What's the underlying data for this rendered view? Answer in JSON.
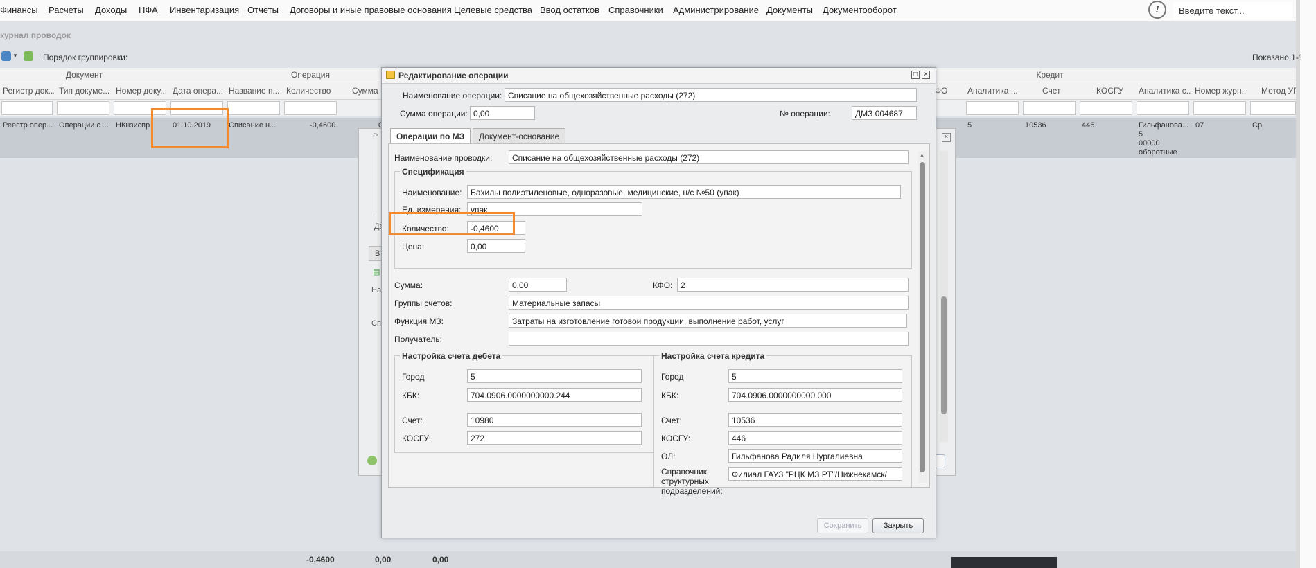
{
  "menu": [
    "Финансы",
    "Расчеты",
    "Доходы",
    "НФА",
    "Инвентаризация",
    "Отчеты",
    "Договоры и иные правовые основания",
    "Целевые средства",
    "Ввод остатков",
    "Справочники",
    "Администрирование",
    "Документы",
    "Документооборот"
  ],
  "search": {
    "placeholder": "Введите текст..."
  },
  "journal": {
    "title": "курнал проводок",
    "group_order_label": "Порядок группировки:",
    "shown": "Показано 1-1",
    "groups": {
      "document": "Документ",
      "operation": "Операция",
      "credit": "Кредит"
    },
    "columns": [
      "Регистр док...",
      "Тип докуме...",
      "Номер доку...",
      "Дата опера...",
      "Название п...",
      "Количество",
      "Сумма",
      "ФО",
      "Аналитика ...",
      "Счет",
      "КОСГУ",
      "Аналитика с...",
      "Номер журн...",
      "Метод УП"
    ],
    "row": {
      "register": "Реестр опер...",
      "doc_type": "Операции с ...",
      "doc_number": "НКнзиспр",
      "date": "01.10.2019",
      "name": "Списание н...",
      "quantity": "-0,4600",
      "sum": "0",
      "credit_analytics": "5",
      "credit_account": "10536",
      "credit_kosgu": "446",
      "analytics_s": [
        "Гильфанова...",
        "5",
        "00000",
        "оборотные"
      ],
      "journal_num": "07",
      "method": "Ср"
    },
    "totals": [
      "-0,4600",
      "0,00",
      "0,00"
    ]
  },
  "bg_dialog": {
    "title_letter": "Р",
    "label_d": "Да",
    "label_nac": "Нас",
    "label_sp": "Спи",
    "tab_letter": "В"
  },
  "dialog": {
    "title": "Редактирование операции",
    "op_name_label": "Наименование операции:",
    "op_name": "Списание на общехозяйственные расходы (272)",
    "op_sum_label": "Сумма операции:",
    "op_sum": "0,00",
    "op_num_label": "№ операции:",
    "op_num": "ДМЗ 004687",
    "tabs": [
      "Операции по МЗ",
      "Документ-основание"
    ],
    "posting_name_label": "Наименование проводки:",
    "posting_name": "Списание на общехозяйственные расходы (272)",
    "spec": {
      "legend": "Спецификация",
      "name_label": "Наименование:",
      "name": "Бахилы  полиэтиленовые, одноразовые, медицинские, н/с №50 (упак)",
      "unit_label": "Ед. измерения:",
      "unit": "упак",
      "qty_label": "Количество:",
      "qty": "-0,4600",
      "price_label": "Цена:",
      "price": "0,00"
    },
    "sum_label": "Сумма:",
    "sum": "0,00",
    "kfo_label": "КФО:",
    "kfo": "2",
    "groups_label": "Группы счетов:",
    "groups": "Материальные запасы",
    "func_label": "Функция МЗ:",
    "func": "Затраты на изготовление готовой продукции, выполнение работ, услуг",
    "receiver_label": "Получатель:",
    "receiver": "",
    "debit": {
      "legend": "Настройка счета дебета",
      "city_label": "Город",
      "city": "5",
      "kbk_label": "КБК:",
      "kbk": "704.0906.0000000000.244",
      "account_label": "Счет:",
      "account": "10980",
      "kosgu_label": "КОСГУ:",
      "kosgu": "272"
    },
    "credit": {
      "legend": "Настройка счета кредита",
      "city_label": "Город",
      "city": "5",
      "kbk_label": "КБК:",
      "kbk": "704.0906.0000000000.000",
      "account_label": "Счет:",
      "account": "10536",
      "kosgu_label": "КОСГУ:",
      "kosgu": "446",
      "ol_label": "ОЛ:",
      "ol": "Гильфанова Радиля Нургалиевна",
      "dept_label_1": "Справочник",
      "dept_label_2": "структурных",
      "dept_label_3": "подразделений:",
      "dept": "Филиал ГАУЗ \"РЦК МЗ РТ\"/Нижнекамск/"
    },
    "save_label": "Сохранить",
    "close_label": "Закрыть"
  },
  "colors": {
    "highlight": "#f28a2e",
    "selected_row": "#c7ccd3"
  }
}
